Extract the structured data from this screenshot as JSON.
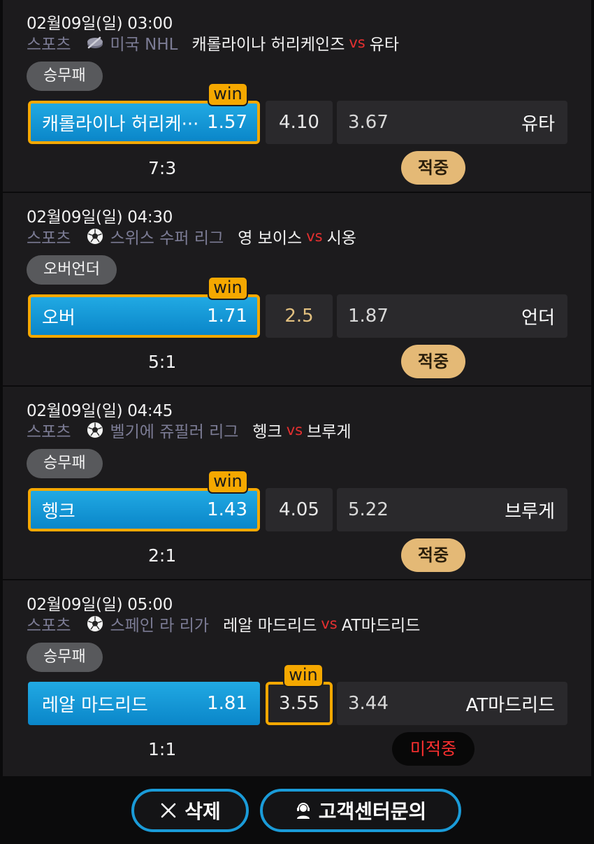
{
  "bets": [
    {
      "time": "02월09일(일) 03:00",
      "category": "스포츠",
      "league_icon": "hockey-puck-icon",
      "league": "미국 NHL",
      "home_team": "캐롤라이나 허리케인즈",
      "vs": "vs",
      "away_team": "유타",
      "market": "승무패",
      "home_label": "캐롤라이나 허리케···",
      "home_odds": "1.57",
      "draw_odds": "4.10",
      "away_odds": "3.67",
      "away_label": "유타",
      "win_tag": "win",
      "score": "7:3",
      "result": "적중"
    },
    {
      "time": "02월09일(일) 04:30",
      "category": "스포츠",
      "league_icon": "soccer-ball-icon",
      "league": "스위스 수퍼 리그",
      "home_team": "영 보이스",
      "vs": "vs",
      "away_team": "시옹",
      "market": "오버언더",
      "home_label": "오버",
      "home_odds": "1.71",
      "draw_odds": "2.5",
      "away_odds": "1.87",
      "away_label": "언더",
      "win_tag": "win",
      "score": "5:1",
      "result": "적중"
    },
    {
      "time": "02월09일(일) 04:45",
      "category": "스포츠",
      "league_icon": "soccer-ball-icon",
      "league": "벨기에 쥬필러 리그",
      "home_team": "헹크",
      "vs": "vs",
      "away_team": "브루게",
      "market": "승무패",
      "home_label": "헹크",
      "home_odds": "1.43",
      "draw_odds": "4.05",
      "away_odds": "5.22",
      "away_label": "브루게",
      "win_tag": "win",
      "score": "2:1",
      "result": "적중"
    },
    {
      "time": "02월09일(일) 05:00",
      "category": "스포츠",
      "league_icon": "soccer-ball-icon",
      "league": "스페인 라 리가",
      "home_team": "레알 마드리드",
      "vs": "vs",
      "away_team": "AT마드리드",
      "market": "승무패",
      "home_label": "레알 마드리드",
      "home_odds": "1.81",
      "draw_odds": "3.55",
      "away_odds": "3.44",
      "away_label": "AT마드리드",
      "win_tag": "win",
      "score": "1:1",
      "result": "미적중"
    }
  ],
  "actions": {
    "delete_label": "삭제",
    "delete_icon": "close-icon",
    "support_label": "고객센터문의",
    "support_icon": "headset-agent-icon"
  },
  "colors": {
    "card_bg": "#1c1b1d",
    "selected_blue": "#1a9ad6",
    "win_gold": "#f5a800",
    "hit_badge": "#e4b976",
    "miss_text": "#ff3030",
    "vs_red": "#e53030"
  }
}
